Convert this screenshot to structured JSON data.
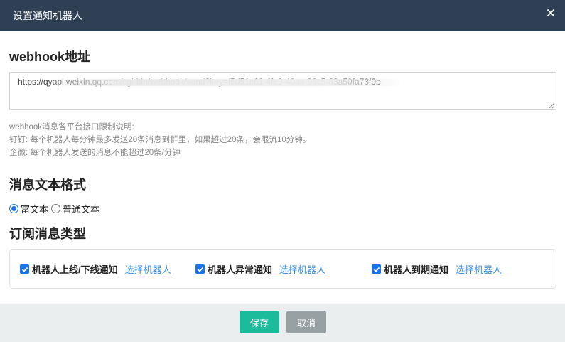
{
  "dialog": {
    "title": "设置通知机器人"
  },
  "webhook": {
    "heading": "webhook地址",
    "value": "https://qyapi.weixin.qq.com/cgi-bin/webhook/send?key=f5d51c61-4fe9-40aa-96c5-83a50fa73f9b"
  },
  "notes": {
    "line1": "webhook消息各平台接口限制说明:",
    "line2": "钉钉: 每个机器人每分钟最多发送20条消息到群里，如果超过20条，会限流10分钟。",
    "line3": "企微: 每个机器人发送的消息不能超过20条/分钟"
  },
  "format": {
    "heading": "消息文本格式",
    "options": [
      {
        "label": "富文本",
        "checked": true
      },
      {
        "label": "普通文本",
        "checked": false
      }
    ]
  },
  "subscriptions": {
    "heading": "订阅消息类型",
    "items": [
      {
        "label": "机器人上线/下线通知",
        "link": "选择机器人",
        "checked": true
      },
      {
        "label": "机器人异常通知",
        "link": "选择机器人",
        "checked": true
      },
      {
        "label": "机器人到期通知",
        "link": "选择机器人",
        "checked": true
      }
    ]
  },
  "buttons": {
    "save": "保存",
    "cancel": "取消"
  },
  "colors": {
    "titlebar": "#2f4054",
    "save": "#1abc9c",
    "cancel": "#97a1a3",
    "link": "#3a8ee6",
    "accent": "#1a73e8"
  }
}
